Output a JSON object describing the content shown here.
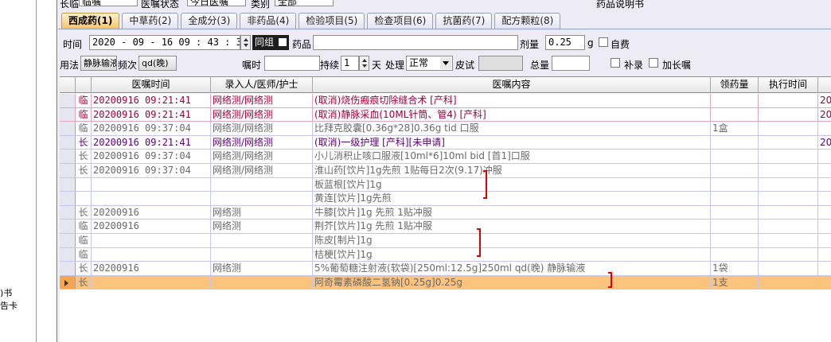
{
  "left_fragments": [
    ")书",
    "告卡"
  ],
  "top_row": {
    "label1": "长临",
    "value1": "临嘱",
    "label2": "医嘱状态",
    "value2": "今日医嘱",
    "label3": "类别",
    "value3": "全部",
    "label4": "药品说明书"
  },
  "tabs": [
    {
      "label": "西成药(1)",
      "active": true
    },
    {
      "label": "中草药(2)",
      "active": false
    },
    {
      "label": "全成分(3)",
      "active": false
    },
    {
      "label": "非药品(4)",
      "active": false
    },
    {
      "label": "检验项目(5)",
      "active": false
    },
    {
      "label": "检查项目(6)",
      "active": false
    },
    {
      "label": "抗菌药(7)",
      "active": false
    },
    {
      "label": "配方颗粒(8)",
      "active": false
    }
  ],
  "form": {
    "time_label": "时间",
    "time_value": "2020 - 09 - 16   09 : 43 : 39",
    "same_group_label": "同组",
    "drug_label": "药品",
    "dose_label": "剂量",
    "dose_value": "0.25",
    "dose_unit": "g",
    "self_pay_label": "自费",
    "usage_label": "用法",
    "usage_value": "静脉输液",
    "freq_label": "频次",
    "freq_value": "qd(晚)",
    "instruct_time_label": "嘱时",
    "duration_label": "持续",
    "duration_value": "1",
    "day_label": "天",
    "process_label": "处理",
    "process_value": "正常",
    "skin_test_label": "皮试",
    "total_label": "总量",
    "supplement_label": "补录",
    "extend_label": "加长嘱"
  },
  "grid": {
    "headers": [
      "",
      "",
      "医嘱时间",
      "录入人/医师/护士",
      "医嘱内容",
      "领药量",
      "执行时间",
      ""
    ],
    "rows": [
      {
        "type": "临",
        "time": "20200916 09:21:41",
        "who": "网络测/网络测",
        "content": "(取消)烧伤瘢痕切除缝合术   [产科]",
        "qty": "",
        "exec": "",
        "extra": "20",
        "style": "red"
      },
      {
        "type": "临",
        "time": "20200916 09:21:41",
        "who": "网络测/网络测",
        "content": "(取消)静脉采血(10ML针筒、管4)     [产科]",
        "qty": "",
        "exec": "",
        "extra": "20",
        "style": "red"
      },
      {
        "type": "临",
        "time": "20200916 09:37:04",
        "who": "网络测/网络测",
        "content": "比拜克胶囊[0.36g*28]0.36g tid 口服",
        "qty": "1盒",
        "exec": "",
        "extra": "",
        "style": "gray"
      },
      {
        "type": "长",
        "time": "20200916 09:21:41",
        "who": "网络测/网络测",
        "content": "(取消)一级护理    [产科][未申请]",
        "qty": "",
        "exec": "",
        "extra": "20",
        "style": "purple"
      },
      {
        "type": "长",
        "time": "20200916 09:37:04",
        "who": "网络测/网络测",
        "content": "小儿消积止咳口服液[10ml*6]10ml bid [首1]口服",
        "qty": "",
        "exec": "",
        "extra": "",
        "style": "gray"
      },
      {
        "type": "长",
        "time": "20200916 09:37:04",
        "who": "网络测/网络测",
        "content": "淮山药[饮片]1g先煎   1贴每日2次(9.17)冲服",
        "qty": "",
        "exec": "",
        "extra": "",
        "style": "gray"
      },
      {
        "type": "",
        "time": "",
        "who": "",
        "content": "板蓝根[饮片]1g",
        "qty": "",
        "exec": "",
        "extra": "",
        "style": "gray"
      },
      {
        "type": "",
        "time": "",
        "who": "",
        "content": "黄连[饮片]1g先煎",
        "qty": "",
        "exec": "",
        "extra": "",
        "style": "gray"
      },
      {
        "type": "长",
        "time": "20200916",
        "who": "网络测",
        "content": "牛膝[饮片]1g 先煎 1贴冲服",
        "qty": "",
        "exec": "",
        "extra": "",
        "style": "gray"
      },
      {
        "type": "临",
        "time": "20200916",
        "who": "网络测",
        "content": "荆芥[饮片]1g 先煎  1贴冲服",
        "qty": "",
        "exec": "",
        "extra": "",
        "style": "gray"
      },
      {
        "type": "临",
        "time": "",
        "who": "",
        "content": "陈皮[制片]1g",
        "qty": "",
        "exec": "",
        "extra": "",
        "style": "gray"
      },
      {
        "type": "临",
        "time": "",
        "who": "",
        "content": "桔梗[饮片]1g",
        "qty": "",
        "exec": "",
        "extra": "",
        "style": "gray"
      },
      {
        "type": "长",
        "time": "20200916",
        "who": "网络测",
        "content": "5%葡萄糖注射液(软袋)[250ml:12.5g]250ml qd(晚) 静脉输液",
        "qty": "1袋",
        "exec": "",
        "extra": "",
        "style": "gray"
      },
      {
        "type": "长",
        "time": "",
        "who": "",
        "content": "阿奇霉素磷酸二氢钠[0.25g]0.25g",
        "qty": "1支",
        "exec": "",
        "extra": "",
        "style": "sel"
      }
    ]
  },
  "colors": {
    "tab_active": "#f2c46b",
    "row_selected": "#fbc37c",
    "text_cancelled": "#a0003c",
    "text_purple": "#5b0079",
    "bracket": "#e00000"
  }
}
